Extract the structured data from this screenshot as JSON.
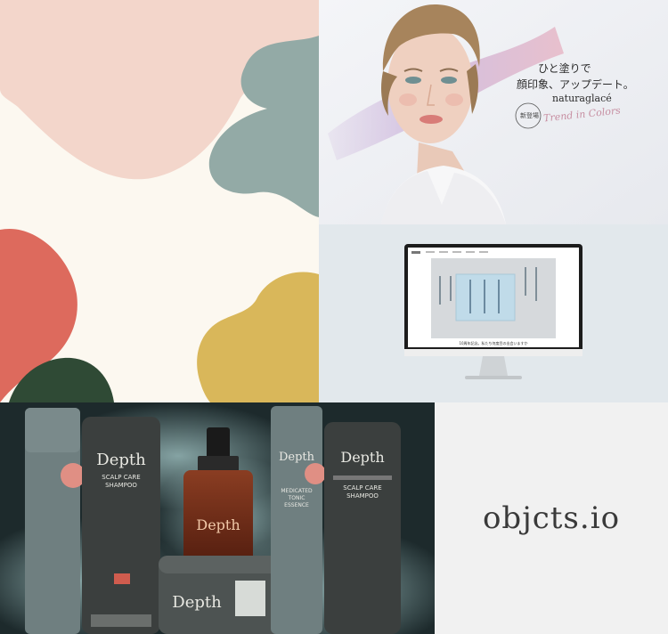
{
  "portrait": {
    "headline_1": "ひと塗りで",
    "headline_2": "顔印象、アップデート。",
    "brand": "naturaglacé",
    "badge": "新登場",
    "script": "Trend in Colors"
  },
  "monitor": {
    "caption": "10周年記念。私たち何度目の出会いますか"
  },
  "depth": {
    "brand": "Depth",
    "products": [
      {
        "name_1": "SCALP CARE",
        "name_2": "SHAMPOO"
      },
      {
        "name_1": "MEDICATED",
        "name_2": "TONIC",
        "name_3": "ESSENCE"
      },
      {
        "name_1": "SCALP CARE",
        "name_2": "SHAMPOO"
      }
    ]
  },
  "logo": {
    "text": "objcts.io"
  },
  "colors": {
    "abstract_bg": "#fcf8f0",
    "pink": "#f3d6cb",
    "sage": "#93aaa6",
    "coral": "#dd6a5d",
    "mustard": "#d9b75a",
    "forest": "#2f4a35"
  }
}
